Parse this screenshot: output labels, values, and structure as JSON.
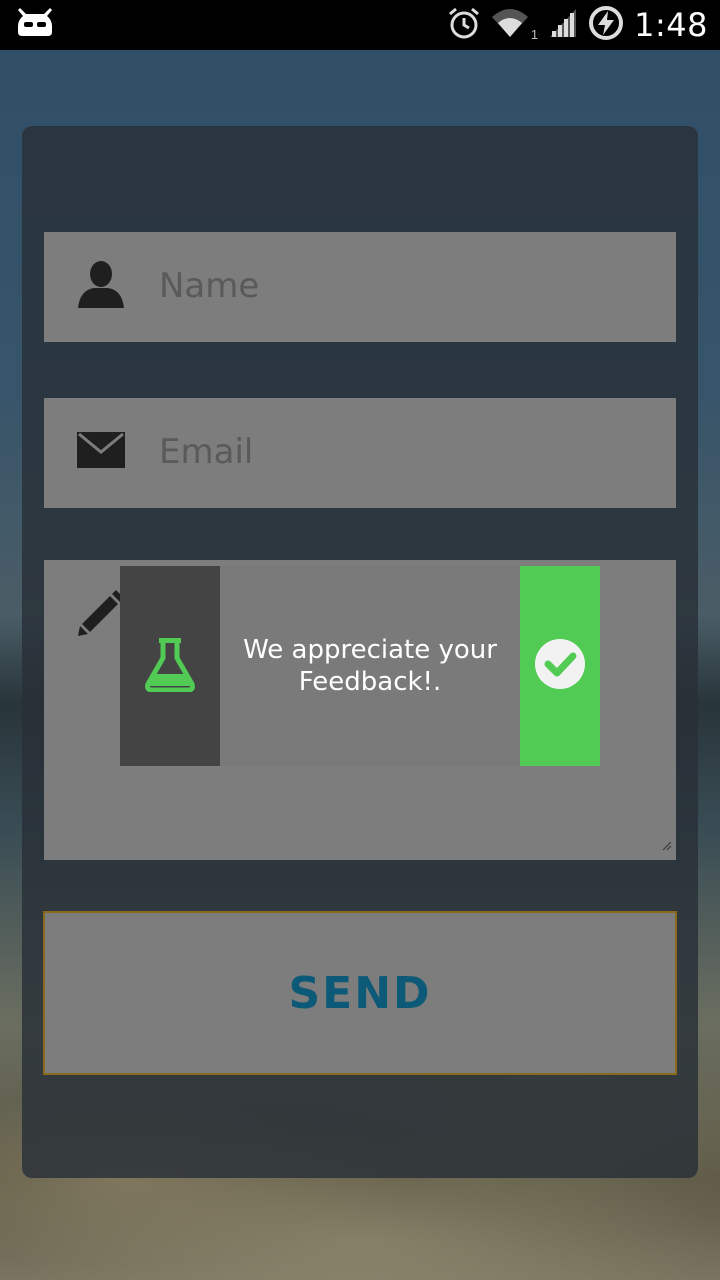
{
  "status_bar": {
    "time": "1:48",
    "signal_sub": "1",
    "icons": [
      "cyanogenmod-bugdroid-icon",
      "alarm-icon",
      "wifi-icon",
      "cell-signal-icon",
      "battery-charging-icon"
    ]
  },
  "form": {
    "name_placeholder": "Name",
    "email_placeholder": "Email",
    "message_placeholder": "",
    "send_label": "SEND"
  },
  "toast": {
    "message": "We appreciate your Feedback!.",
    "colors": {
      "left": "#444444",
      "middle": "#7a7a7a",
      "right": "#51cb53",
      "flask": "#51cb53"
    }
  },
  "colors": {
    "field_bg": "#7d7d7d",
    "send_text": "#0c5a78",
    "send_border": "#8a6a1c"
  }
}
